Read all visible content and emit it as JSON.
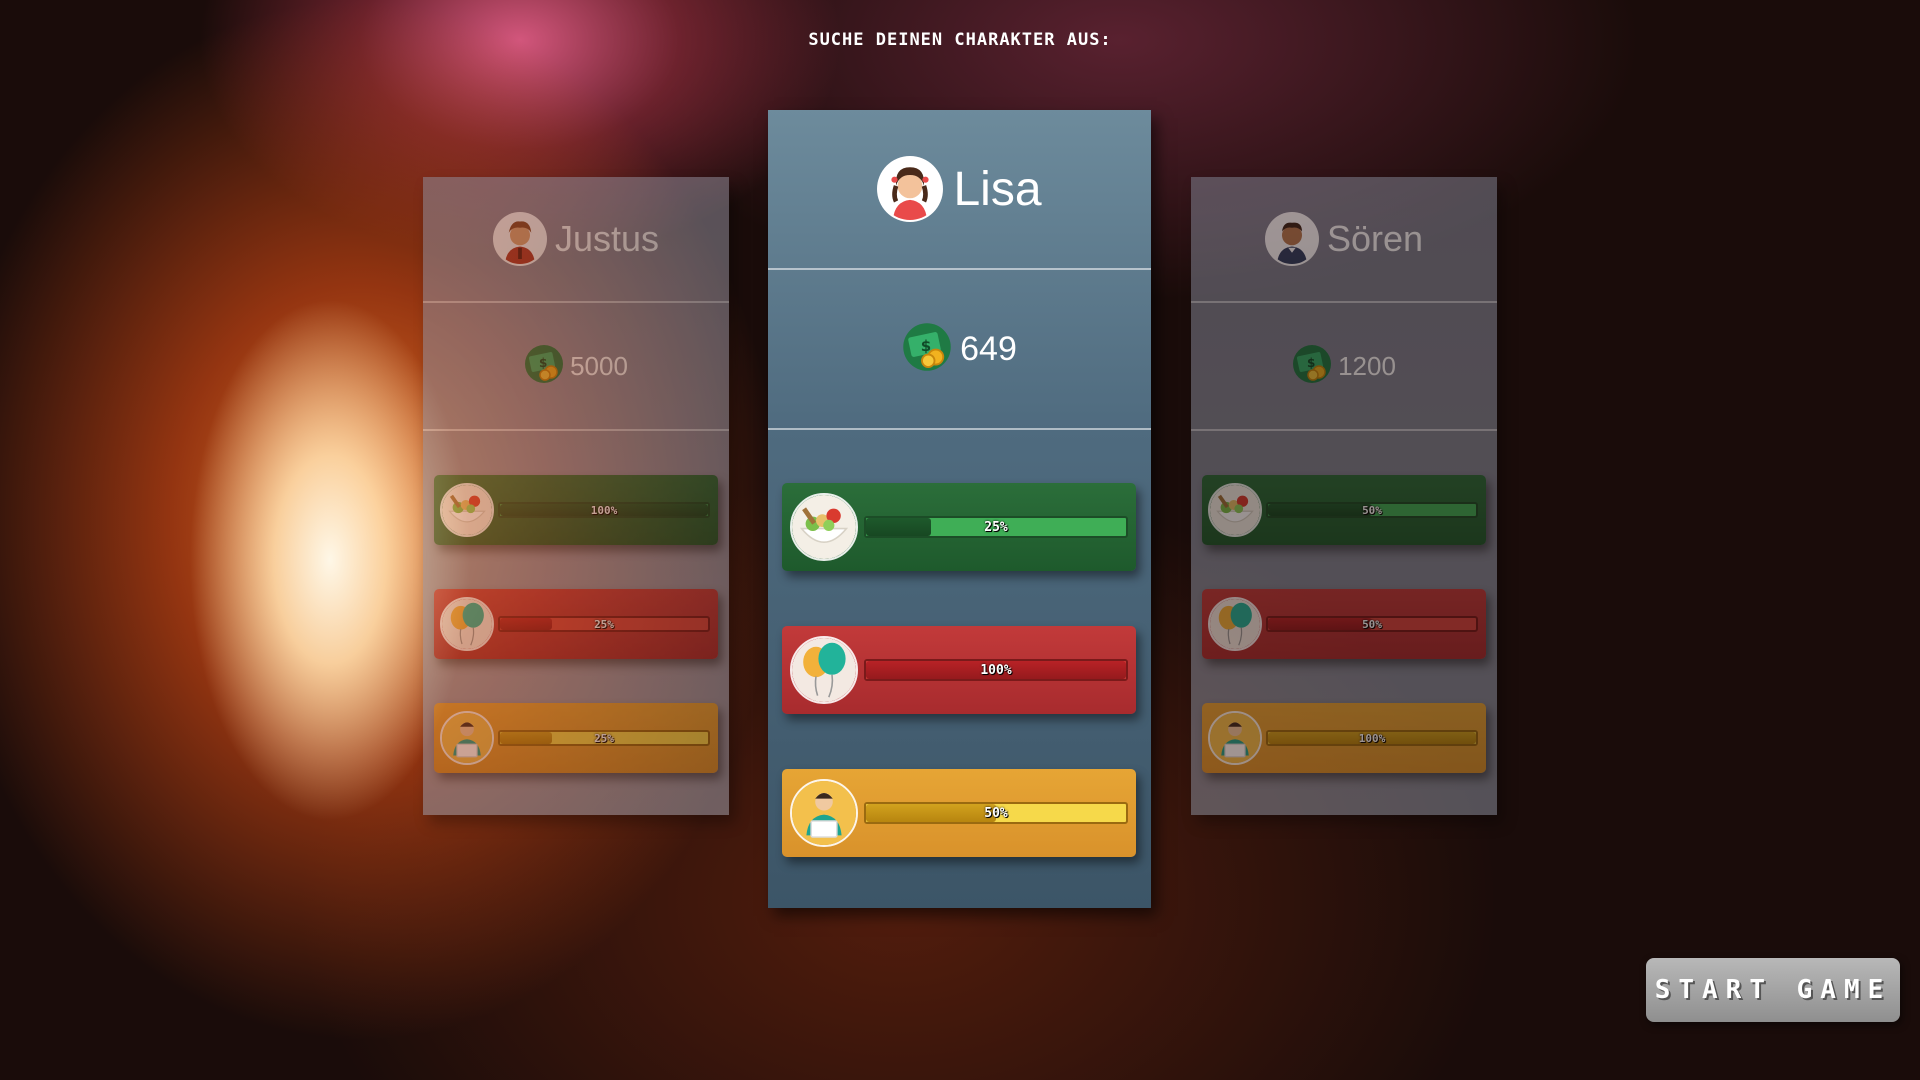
{
  "title": "SUCHE DEINEN CHARAKTER AUS:",
  "characters": [
    {
      "name": "Justus",
      "money": "5000",
      "selected": false,
      "stats": {
        "food": {
          "label": "100%",
          "value": 100
        },
        "fun": {
          "label": "25%",
          "value": 25
        },
        "work": {
          "label": "25%",
          "value": 25
        }
      }
    },
    {
      "name": "Lisa",
      "money": "649",
      "selected": true,
      "stats": {
        "food": {
          "label": "25%",
          "value": 25
        },
        "fun": {
          "label": "100%",
          "value": 100
        },
        "work": {
          "label": "50%",
          "value": 50
        }
      }
    },
    {
      "name": "Sören",
      "money": "1200",
      "selected": false,
      "stats": {
        "food": {
          "label": "50%",
          "value": 50
        },
        "fun": {
          "label": "50%",
          "value": 50
        },
        "work": {
          "label": "100%",
          "value": 100
        }
      }
    }
  ],
  "icons": {
    "money": "money-coins-icon",
    "food": "food-bowl-icon",
    "fun": "balloons-icon",
    "work": "office-worker-icon"
  },
  "colors": {
    "food": "#2b6e3a",
    "fun": "#c23a3a",
    "work": "#e6a535",
    "card_selected": "#5e7d90"
  },
  "start_button": "START GAME"
}
